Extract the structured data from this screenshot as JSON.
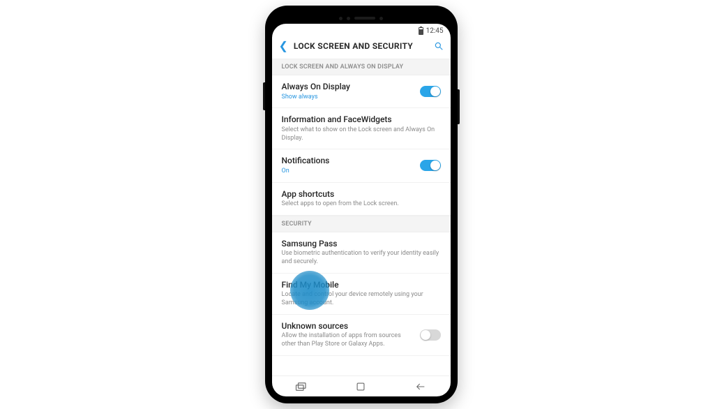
{
  "status": {
    "time": "12:45"
  },
  "header": {
    "title": "LOCK SCREEN AND SECURITY"
  },
  "sections": {
    "s1": {
      "label": "LOCK SCREEN AND ALWAYS ON DISPLAY",
      "items": {
        "aod": {
          "title": "Always On Display",
          "sub": "Show always",
          "toggle": true
        },
        "info": {
          "title": "Information and FaceWidgets",
          "sub": "Select what to show on the Lock screen and Always On Display."
        },
        "notif": {
          "title": "Notifications",
          "sub": "On",
          "toggle": true
        },
        "short": {
          "title": "App shortcuts",
          "sub": "Select apps to open from the Lock screen."
        }
      }
    },
    "s2": {
      "label": "SECURITY",
      "items": {
        "pass": {
          "title": "Samsung Pass",
          "sub": "Use biometric authentication to verify your identity easily and securely."
        },
        "findmy": {
          "title": "Find My Mobile",
          "sub": "Locate and control your device remotely using your Samsung account."
        },
        "unknown": {
          "title": "Unknown sources",
          "sub": "Allow the installation of apps from sources other than Play Store or Galaxy Apps.",
          "toggle": false
        }
      }
    }
  }
}
